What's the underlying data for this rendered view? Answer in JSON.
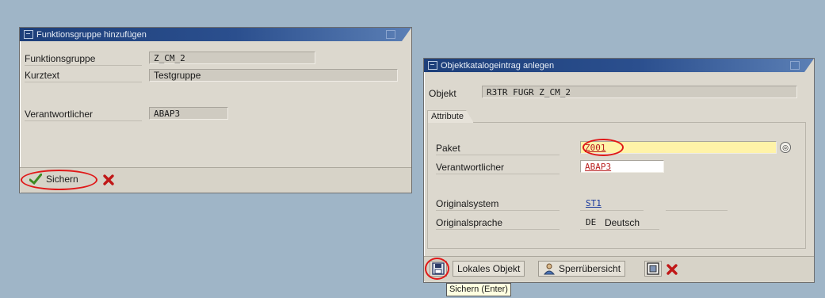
{
  "dialog1": {
    "title": "Funktionsgruppe hinzufügen",
    "fields": {
      "function_group_label": "Funktionsgruppe",
      "function_group_value": "Z_CM_2",
      "short_text_label": "Kurztext",
      "short_text_value": "Testgruppe",
      "responsible_label": "Verantwortlicher",
      "responsible_value": "ABAP3"
    },
    "toolbar": {
      "save_label": "Sichern"
    }
  },
  "dialog2": {
    "title": "Objektkatalogeintrag anlegen",
    "object_label": "Objekt",
    "object_value": "R3TR FUGR Z_CM_2",
    "group_title": "Attribute",
    "fields": {
      "package_label": "Paket",
      "package_value": "Z001",
      "responsible_label": "Verantwortlicher",
      "responsible_value": "ABAP3",
      "original_system_label": "Originalsystem",
      "original_system_value": "ST1",
      "original_language_label": "Originalsprache",
      "original_language_code": "DE",
      "original_language_name": "Deutsch"
    },
    "toolbar": {
      "local_object_label": "Lokales Objekt",
      "lock_overview_label": "Sperrübersicht"
    },
    "tooltip": "Sichern  (Enter)"
  },
  "colors": {
    "title_bar": "#1d3f7a",
    "highlight_oval": "#e01818",
    "required_field": "#fff3a8",
    "cancel_x": "#c01818",
    "check": "#3d8a22"
  },
  "icons": [
    "checkmark-icon",
    "cancel-x-icon",
    "save-icon",
    "person-icon",
    "copy-icon",
    "f4-help-icon",
    "window-icon"
  ]
}
